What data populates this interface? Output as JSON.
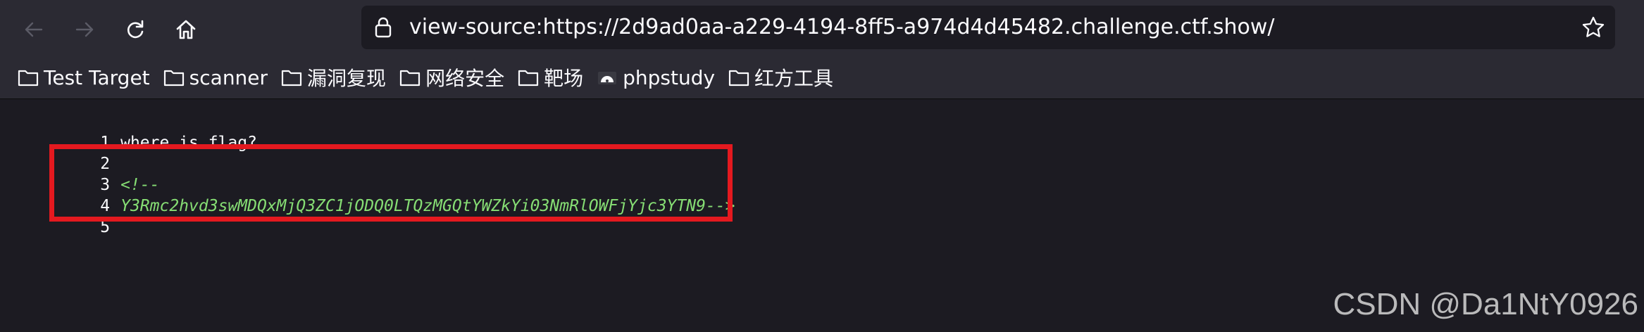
{
  "browser": {
    "url": "view-source:https://2d9ad0aa-a229-4194-8ff5-a974d4d45482.challenge.ctf.show/",
    "icons": {
      "back": "arrow-left-icon",
      "forward": "arrow-right-icon",
      "reload": "reload-icon",
      "home": "home-icon",
      "lock": "lock-icon",
      "bookmark_star": "star-icon"
    }
  },
  "bookmarks": [
    {
      "label": "Test Target",
      "icon": "folder-icon"
    },
    {
      "label": "scanner",
      "icon": "folder-icon"
    },
    {
      "label": "漏洞复现",
      "icon": "folder-icon"
    },
    {
      "label": "网络安全",
      "icon": "folder-icon"
    },
    {
      "label": "靶场",
      "icon": "folder-icon"
    },
    {
      "label": "phpstudy",
      "icon": "site-favicon-icon"
    },
    {
      "label": "红方工具",
      "icon": "folder-icon"
    }
  ],
  "source": {
    "lines": [
      {
        "number": "1",
        "text": "where is flag?"
      },
      {
        "number": "2",
        "text": ""
      },
      {
        "number": "3",
        "text": "<!--"
      },
      {
        "number": "4",
        "text": "Y3Rmc2hvd3swMDQxMjQ3ZC1jODQ0LTQzMGQtYWZkYi03NmRlOWFjYjc3YTN9-->"
      },
      {
        "number": "5",
        "text": ""
      }
    ]
  },
  "watermark": "CSDN @Da1NtY0926",
  "colors": {
    "toolbar_bg": "#2b2a33",
    "page_bg": "#1c1b22",
    "text": "#fbfbfe",
    "comment": "#86de74",
    "highlight_box": "#e4191f"
  }
}
